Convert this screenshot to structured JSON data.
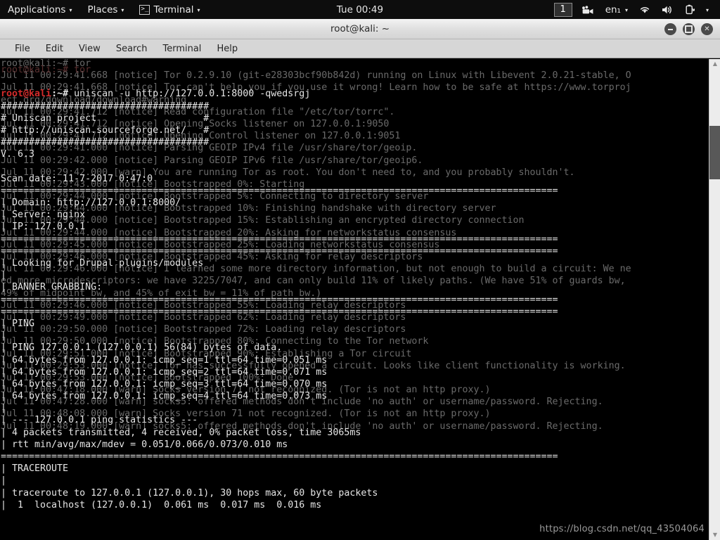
{
  "panel": {
    "applications": "Applications",
    "places": "Places",
    "terminal_app": "Terminal",
    "terminal_icon": "terminal-icon",
    "clock": "Tue 00:49",
    "workspace": "1",
    "tray": {
      "recorder_icon": "video-camera-icon",
      "keyboard_layout": "en₁",
      "wifi_icon": "wifi-icon",
      "volume_icon": "volume-icon",
      "battery_icon": "battery-icon",
      "menu_caret": "▾"
    },
    "caret": "▾"
  },
  "window": {
    "title": "root@kali: ~",
    "buttons": {
      "minimize": "minimize",
      "maximize": "maximize",
      "close": "✕"
    },
    "menu": [
      "File",
      "Edit",
      "View",
      "Search",
      "Terminal",
      "Help"
    ]
  },
  "scrollbar": {
    "up": "▲",
    "down": "▼"
  },
  "watermark": "https://blog.csdn.net/qq_43504064",
  "terminal": {
    "prompt": {
      "user": "root@kali",
      "path": ":~# "
    },
    "background_log": [
      "root@kali:~# tor",
      "Jul 11 00:29:41.668 [notice] Tor 0.2.9.10 (git-e28303bcf90b842d) running on Linux with Libevent 2.0.21-stable, O",
      "Jul 11 00:29:41.668 [notice] Tor can't help you if you use it wrong! Learn how to be safe at https://www.torproj",
      "ect.org/download/download#warning",
      "Jul 11 00:29:41.712 [notice] Read configuration file \"/etc/tor/torrc\".",
      "Jul 11 00:29:41.712 [notice] Opening Socks listener on 127.0.0.1:9050",
      "Jul 11 00:29:41.712 [notice] Opening Control listener on 127.0.0.1:9051",
      "Jul 11 00:29:41.000 [notice] Parsing GEOIP IPv4 file /usr/share/tor/geoip.",
      "Jul 11 00:29:42.000 [notice] Parsing GEOIP IPv6 file /usr/share/tor/geoip6.",
      "Jul 11 00:29:42.000 [warn] You are running Tor as root. You don't need to, and you probably shouldn't.",
      "Jul 11 00:29:43.000 [notice] Bootstrapped 0%: Starting",
      "Jul 11 00:29:44.000 [notice] Bootstrapped 5%: Connecting to directory server",
      "Jul 11 00:29:44.000 [notice] Bootstrapped 10%: Finishing handshake with directory server",
      "Jul 11 00:29:44.000 [notice] Bootstrapped 15%: Establishing an encrypted directory connection",
      "Jul 11 00:29:44.000 [notice] Bootstrapped 20%: Asking for networkstatus consensus",
      "Jul 11 00:29:45.000 [notice] Bootstrapped 25%: Loading networkstatus consensus",
      "Jul 11 00:29:46.000 [notice] Bootstrapped 45%: Asking for relay descriptors",
      "Jul 11 00:29:46.000 [notice] I learned some more directory information, but not enough to build a circuit: We ne",
      "ed more microdescriptors: we have 3225/7047, and can only build 11% of likely paths. (We have 51% of guards bw,",
      "49% of midpoint bw, and 45% of exit bw = 11% of path bw.)",
      "Jul 11 00:29:46.000 [notice] Bootstrapped 55%: Loading relay descriptors",
      "Jul 11 00:29:49.000 [notice] Bootstrapped 62%: Loading relay descriptors",
      "Jul 11 00:29:50.000 [notice] Bootstrapped 72%: Loading relay descriptors",
      "Jul 11 00:29:50.000 [notice] Bootstrapped 80%: Connecting to the Tor network",
      "Jul 11 00:29:51.000 [notice] Bootstrapped 90%: Establishing a Tor circuit",
      "Jul 11 00:29:53.000 [notice] Tor has successfully opened a circuit. Looks like client functionality is working.",
      "Jul 11 00:29:53.000 [notice] Bootstrapped 100%: Done",
      "Jul 11 00:47:18.000 [warn] Socks version 71 not recognized. (Tor is not an http proxy.)",
      "Jul 11 00:47:28.000 [warn] socks5: offered methods don't include 'no auth' or username/password. Rejecting.",
      "Jul 11 00:48:08.000 [warn] Socks version 71 not recognized. (Tor is not an http proxy.)",
      "Jul 11 00:48:19.000 [warn] socks5: offered methods don't include 'no auth' or username/password. Rejecting."
    ],
    "foreground": {
      "first_prompt_line": "root@kali:~# tor",
      "command": "uniscan -u http://127.0.0.1:8000 -qwedsrgj",
      "lines": [
        "#####################################",
        "# Uniscan project                   #",
        "# http://uniscan.sourceforge.net/   #",
        "#####################################",
        "V. 6.3",
        "",
        "Scan date: 11-7-2017 0:47:0",
        "===================================================================================================",
        "| Domain: http://127.0.0.1:8000/",
        "| Server: nginx",
        "| IP: 127.0.0.1",
        "===================================================================================================",
        "===================================================================================================",
        "| Looking for Drupal plugins/modules",
        "|",
        "| BANNER GRABBING:",
        "===================================================================================================",
        "===================================================================================================",
        "| PING",
        "|",
        "| PING 127.0.0.1 (127.0.0.1) 56(84) bytes of data.",
        "| 64 bytes from 127.0.0.1: icmp_seq=1 ttl=64 time=0.051 ms",
        "| 64 bytes from 127.0.0.1: icmp_seq=2 ttl=64 time=0.071 ms",
        "| 64 bytes from 127.0.0.1: icmp_seq=3 ttl=64 time=0.070 ms",
        "| 64 bytes from 127.0.0.1: icmp_seq=4 ttl=64 time=0.073 ms",
        "|",
        "| --- 127.0.0.1 ping statistics ---",
        "| 4 packets transmitted, 4 received, 0% packet loss, time 3065ms",
        "| rtt min/avg/max/mdev = 0.051/0.066/0.073/0.010 ms",
        "===================================================================================================",
        "| TRACEROUTE",
        "|",
        "| traceroute to 127.0.0.1 (127.0.0.1), 30 hops max, 60 byte packets",
        "|  1  localhost (127.0.0.1)  0.061 ms  0.017 ms  0.016 ms"
      ]
    }
  }
}
